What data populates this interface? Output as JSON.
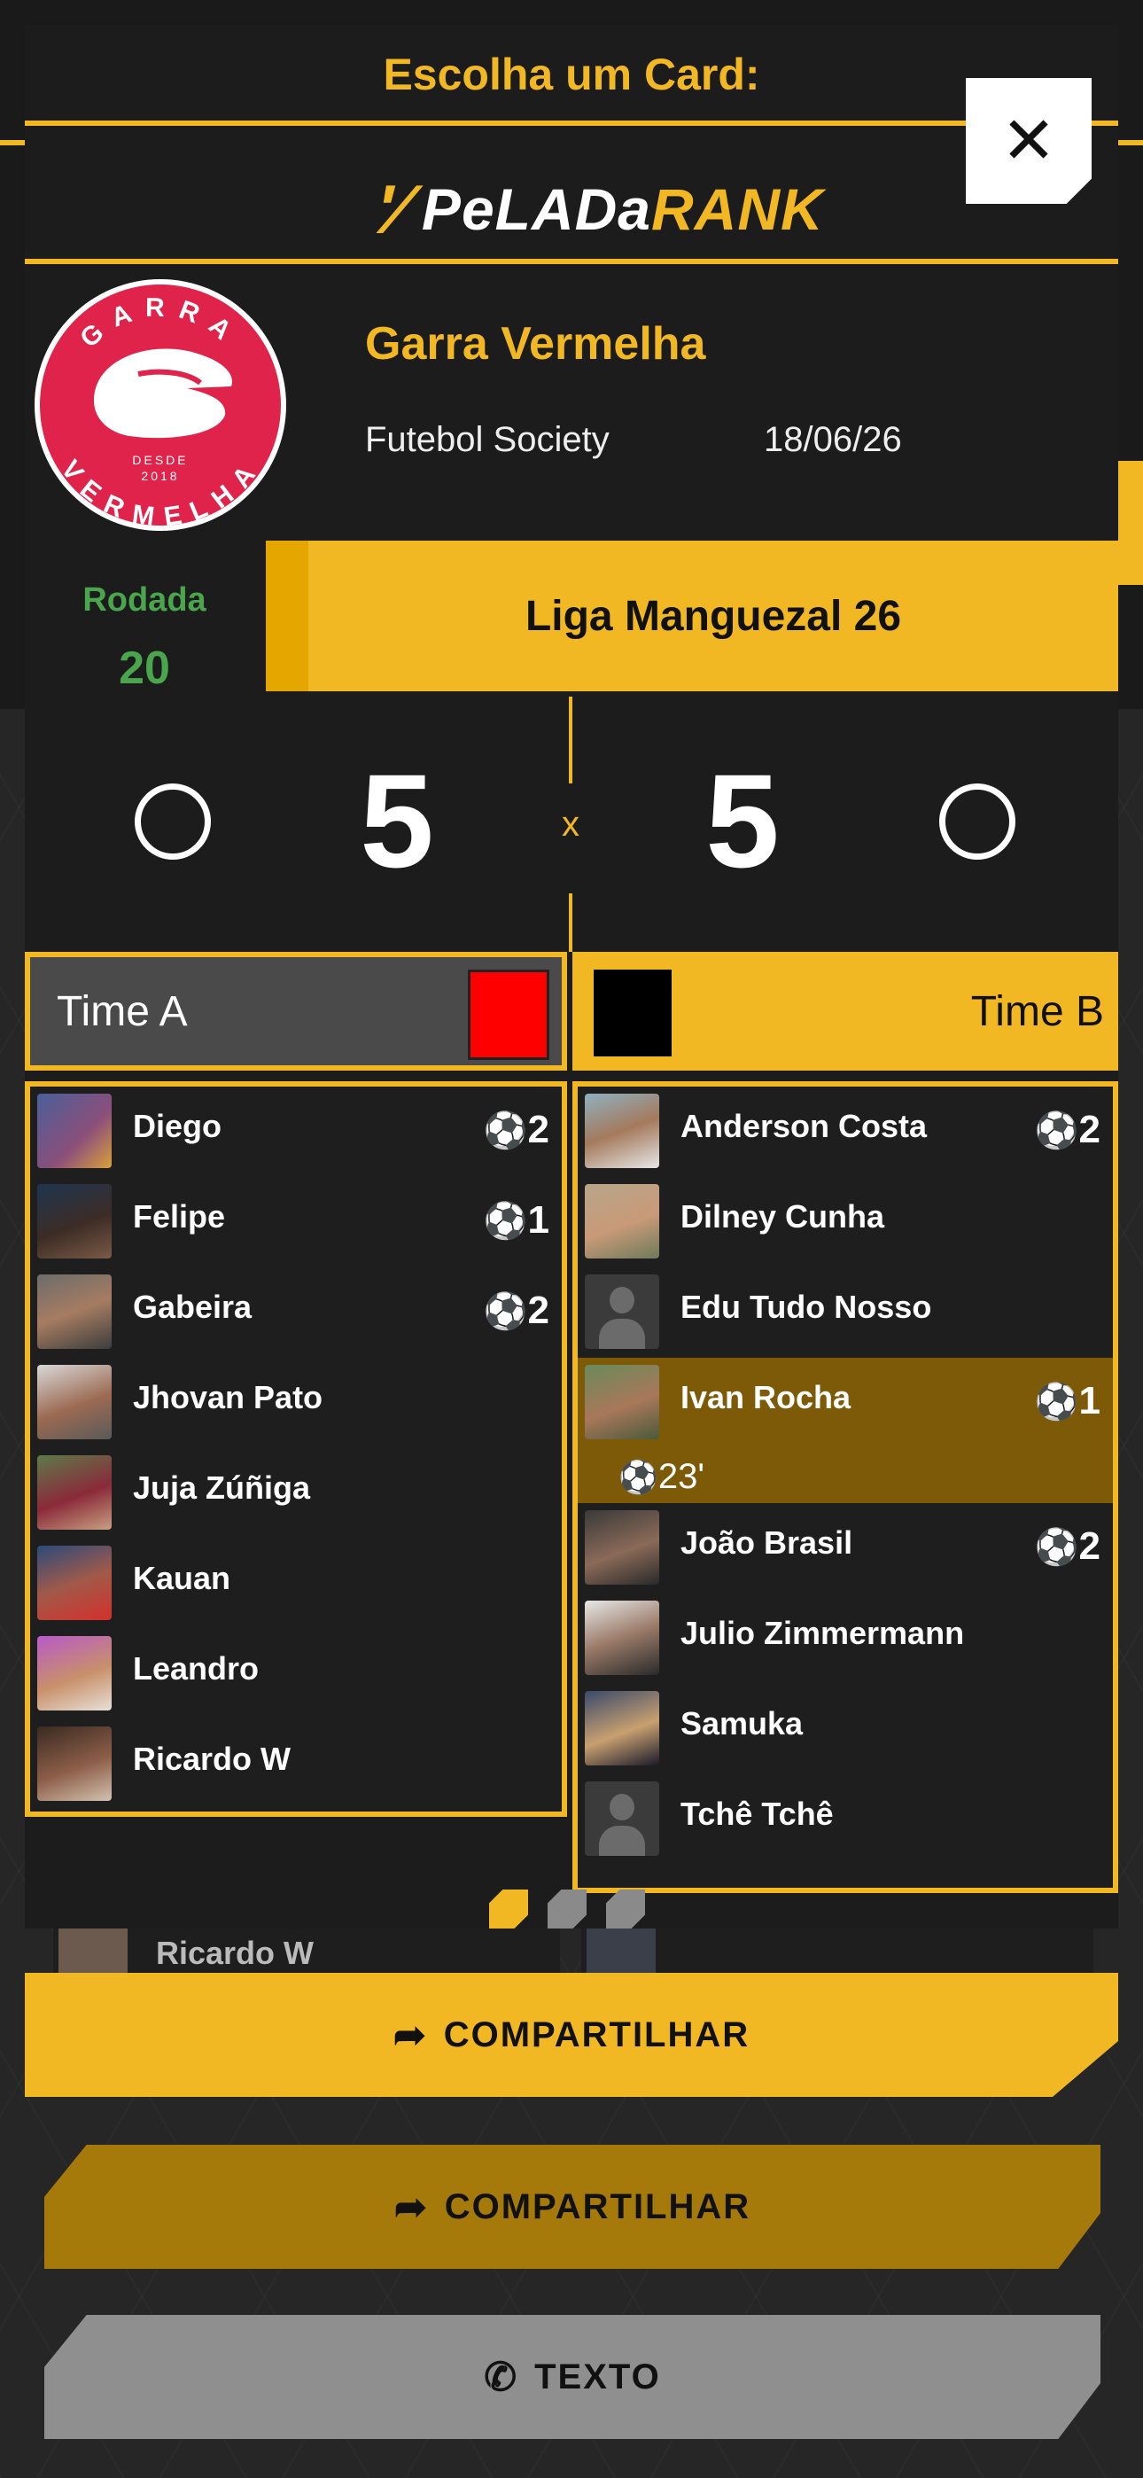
{
  "modal": {
    "title": "Escolha um Card:",
    "close_icon": "✕",
    "logo": {
      "white": "PeLADa",
      "yellow": "RANK",
      "mark": "ʹ⁄"
    }
  },
  "card": {
    "club": {
      "name": "Garra Vermelha",
      "emblem_top": "GARRA",
      "emblem_bottom": "VERMELHA",
      "emblem_since": "DESDE",
      "emblem_year": "2018",
      "color": "#e0234a"
    },
    "modality": "Futebol Society",
    "date": "18/06/26",
    "round_label": "Rodada",
    "round_number": "20",
    "league": "Liga Manguezal 26",
    "score": {
      "a": "5",
      "separator": "x",
      "b": "5"
    },
    "team_a": {
      "label": "Time A",
      "color": "#ff0000",
      "players": [
        {
          "name": "Diego",
          "goals": "2"
        },
        {
          "name": "Felipe",
          "goals": "1"
        },
        {
          "name": "Gabeira",
          "goals": "2"
        },
        {
          "name": "Jhovan Pato",
          "goals": ""
        },
        {
          "name": "Juja Zúñiga",
          "goals": ""
        },
        {
          "name": "Kauan",
          "goals": ""
        },
        {
          "name": "Leandro",
          "goals": ""
        },
        {
          "name": "Ricardo W",
          "goals": ""
        }
      ]
    },
    "team_b": {
      "label": "Time B",
      "color": "#000000",
      "players": [
        {
          "name": "Anderson Costa",
          "goals": "2"
        },
        {
          "name": "Dilney Cunha",
          "goals": ""
        },
        {
          "name": "Edu Tudo Nosso",
          "goals": ""
        },
        {
          "name": "Ivan Rocha",
          "goals": "1",
          "goal_minute": "23'"
        },
        {
          "name": "João Brasil",
          "goals": "2"
        },
        {
          "name": "Julio Zimmermann",
          "goals": ""
        },
        {
          "name": "Samuka",
          "goals": ""
        },
        {
          "name": "Tchê Tchê",
          "goals": ""
        }
      ]
    },
    "ball_icon": "⚽"
  },
  "pager": {
    "count": 3,
    "active": 1
  },
  "background": {
    "row_left_name": "Ricardo W"
  },
  "actions": {
    "share_icon": "➦",
    "share_label": "COMPARTILHAR",
    "share2_label": "COMPARTILHAR",
    "whatsapp_icon": "✆",
    "text_label": "TEXTO"
  },
  "colors": {
    "accent": "#f2b824",
    "round": "#4aa64d",
    "highlight": "#7d5a08"
  }
}
